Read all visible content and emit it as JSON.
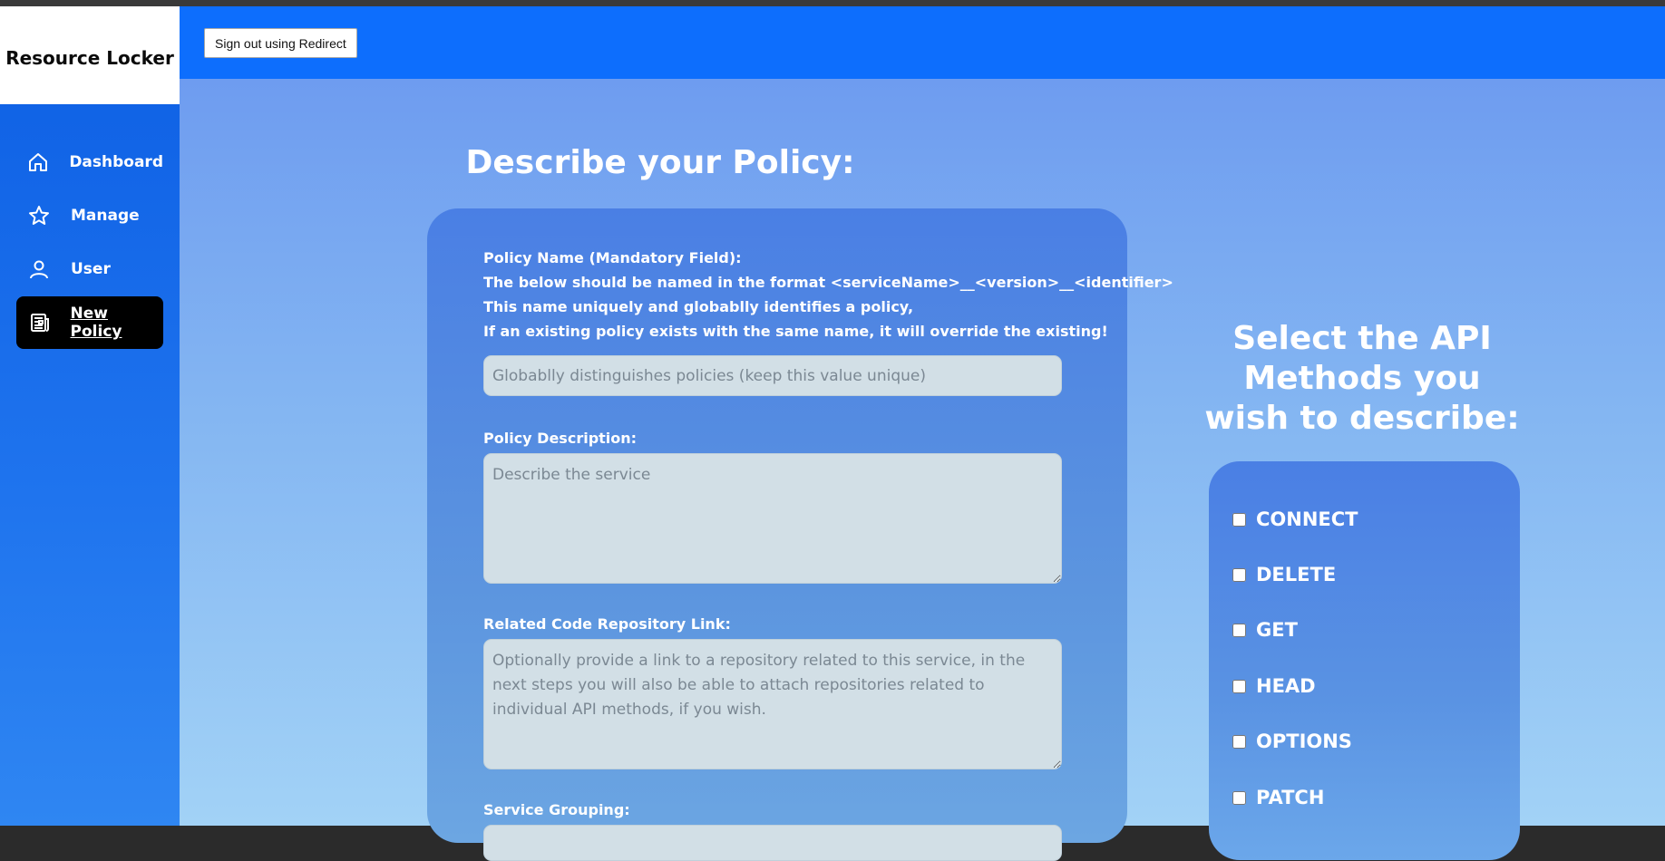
{
  "app": {
    "brand": "Resource Locker"
  },
  "header": {
    "signout_label": "Sign out using Redirect"
  },
  "sidebar": {
    "items": [
      {
        "label": "Dashboard",
        "icon": "home-icon",
        "active": false
      },
      {
        "label": "Manage",
        "icon": "star-icon",
        "active": false
      },
      {
        "label": "User",
        "icon": "user-icon",
        "active": false
      },
      {
        "label": "New Policy",
        "icon": "newspaper-icon",
        "active": true
      }
    ]
  },
  "form": {
    "title": "Describe your Policy:",
    "policy_name": {
      "label_lines": [
        "Policy Name (Mandatory Field):",
        "The below should be named in the format <serviceName>__<version>__<identifier>",
        "This name uniquely and globablly identifies a policy,",
        "If an existing policy exists with the same name, it will override the existing!"
      ],
      "placeholder": "Globablly distinguishes policies (keep this value unique)",
      "value": ""
    },
    "description": {
      "label": "Policy Description:",
      "placeholder": "Describe the service",
      "value": ""
    },
    "repo_link": {
      "label": "Related Code Repository Link:",
      "placeholder": "Optionally provide a link to a repository related to this service, in the next steps you will also be able to attach repositories related to individual API methods, if you wish.",
      "value": ""
    },
    "service_grouping": {
      "label": "Service Grouping:"
    }
  },
  "api_methods": {
    "title": "Select the API Methods you wish to describe:",
    "methods": [
      {
        "label": "CONNECT",
        "checked": false
      },
      {
        "label": "DELETE",
        "checked": false
      },
      {
        "label": "GET",
        "checked": false
      },
      {
        "label": "HEAD",
        "checked": false
      },
      {
        "label": "OPTIONS",
        "checked": false
      },
      {
        "label": "PATCH",
        "checked": false
      }
    ]
  },
  "colors": {
    "header_bg": "#0d6efd",
    "sidebar_bg": "#0d5fe4",
    "active_nav_bg": "#000000",
    "card_bg": "#4a7fe4",
    "input_bg": "#d2dfe6"
  }
}
